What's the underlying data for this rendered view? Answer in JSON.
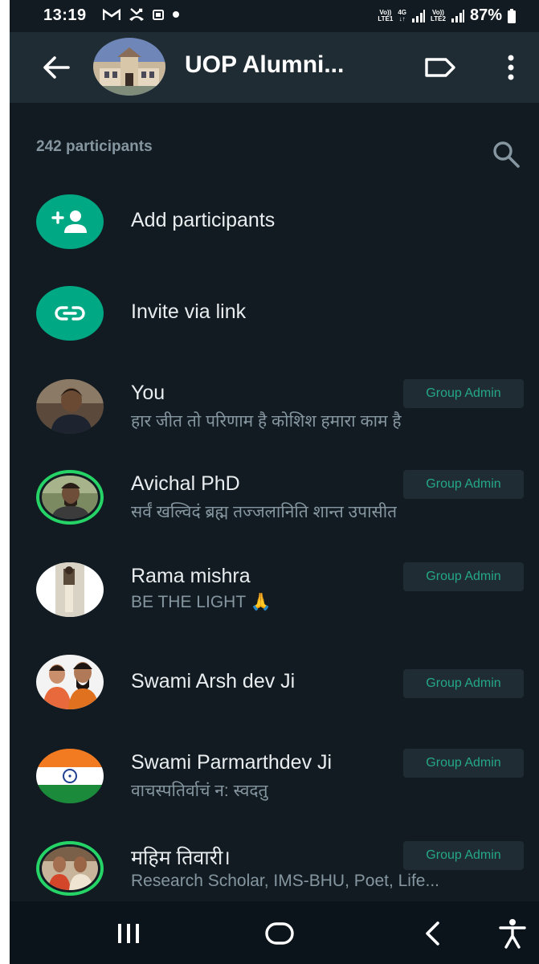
{
  "status_bar": {
    "time": "13:19",
    "battery": "87%",
    "sim1_tag_top": "Vo))",
    "sim1_tag_bottom": "LTE1",
    "net_tag_top": "4G",
    "sim2_tag_top": "Vo))",
    "sim2_tag_bottom": "LTE2"
  },
  "app_bar": {
    "title": "UOP Alumni...",
    "icons": [
      "back-arrow-icon",
      "group-avatar",
      "label-icon",
      "more-vert-icon"
    ]
  },
  "participants": {
    "count_label": "242 participants",
    "search_icon": "search-icon"
  },
  "actions": [
    {
      "label": "Add participants",
      "icon": "add-person-icon"
    },
    {
      "label": "Invite via link",
      "icon": "link-icon"
    }
  ],
  "members": [
    {
      "name": "You",
      "about": "हार जीत तो परिणाम है कोशिश हमारा काम है",
      "badge": "Group Admin",
      "status_ring": false
    },
    {
      "name": "Avichal PhD",
      "about": "सर्वं खल्विदं ब्रह्म तज्जलानिति शान्त उपासीत",
      "badge": "Group Admin",
      "status_ring": true
    },
    {
      "name": "Rama mishra",
      "about": "BE THE LIGHT 🙏",
      "badge": "Group Admin",
      "status_ring": false
    },
    {
      "name": "Swami Arsh dev Ji",
      "about": "",
      "badge": "Group Admin",
      "status_ring": false
    },
    {
      "name": "Swami Parmarthdev Ji",
      "about": "वाचस्पतिर्वाचं न: स्वदतु",
      "badge": "Group Admin",
      "status_ring": false
    },
    {
      "name": "महिम तिवारी।",
      "about": "Research Scholar, IMS-BHU, Poet, Life...",
      "badge": "Group Admin",
      "status_ring": true
    }
  ],
  "nav_bar": {
    "icons": [
      "recent-apps-icon",
      "home-icon",
      "back-icon",
      "accessibility-icon"
    ]
  },
  "colors": {
    "background": "#111b21",
    "app_bar": "#1f2c34",
    "accent": "#00a884",
    "badge_text": "#25a884",
    "primary_text": "#e9edef",
    "secondary_text": "#8696a0"
  }
}
